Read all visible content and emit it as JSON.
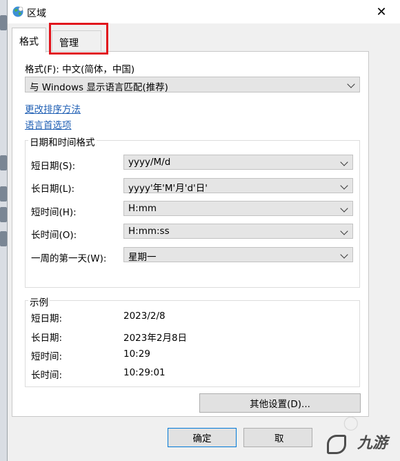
{
  "window": {
    "title": "区域",
    "close_glyph": "✕"
  },
  "tabs": [
    {
      "label": "格式",
      "active": true
    },
    {
      "label": "管理",
      "active": false
    }
  ],
  "format": {
    "label": "格式(F): 中文(简体，中国)",
    "selected": "与 Windows 显示语言匹配(推荐)"
  },
  "links": {
    "sort": "更改排序方法",
    "language": "语言首选项"
  },
  "datetime": {
    "title": "日期和时间格式",
    "rows": [
      {
        "label": "短日期(S):",
        "value": "yyyy/M/d"
      },
      {
        "label": "长日期(L):",
        "value": "yyyy'年'M'月'd'日'"
      },
      {
        "label": "短时间(H):",
        "value": "H:mm"
      },
      {
        "label": "长时间(O):",
        "value": "H:mm:ss"
      },
      {
        "label": "一周的第一天(W):",
        "value": "星期一"
      }
    ]
  },
  "example": {
    "title": "示例",
    "rows": [
      {
        "label": "短日期:",
        "value": "2023/2/8"
      },
      {
        "label": "长日期:",
        "value": "2023年2月8日"
      },
      {
        "label": "短时间:",
        "value": "10:29"
      },
      {
        "label": "长时间:",
        "value": "10:29:01"
      }
    ]
  },
  "buttons": {
    "other": "其他设置(D)...",
    "ok": "确定",
    "cancel": "取"
  },
  "watermark": {
    "text": "九游"
  },
  "colors": {
    "highlight": "#e1141c",
    "link": "#1f5fb4",
    "focus": "#0078d7"
  }
}
